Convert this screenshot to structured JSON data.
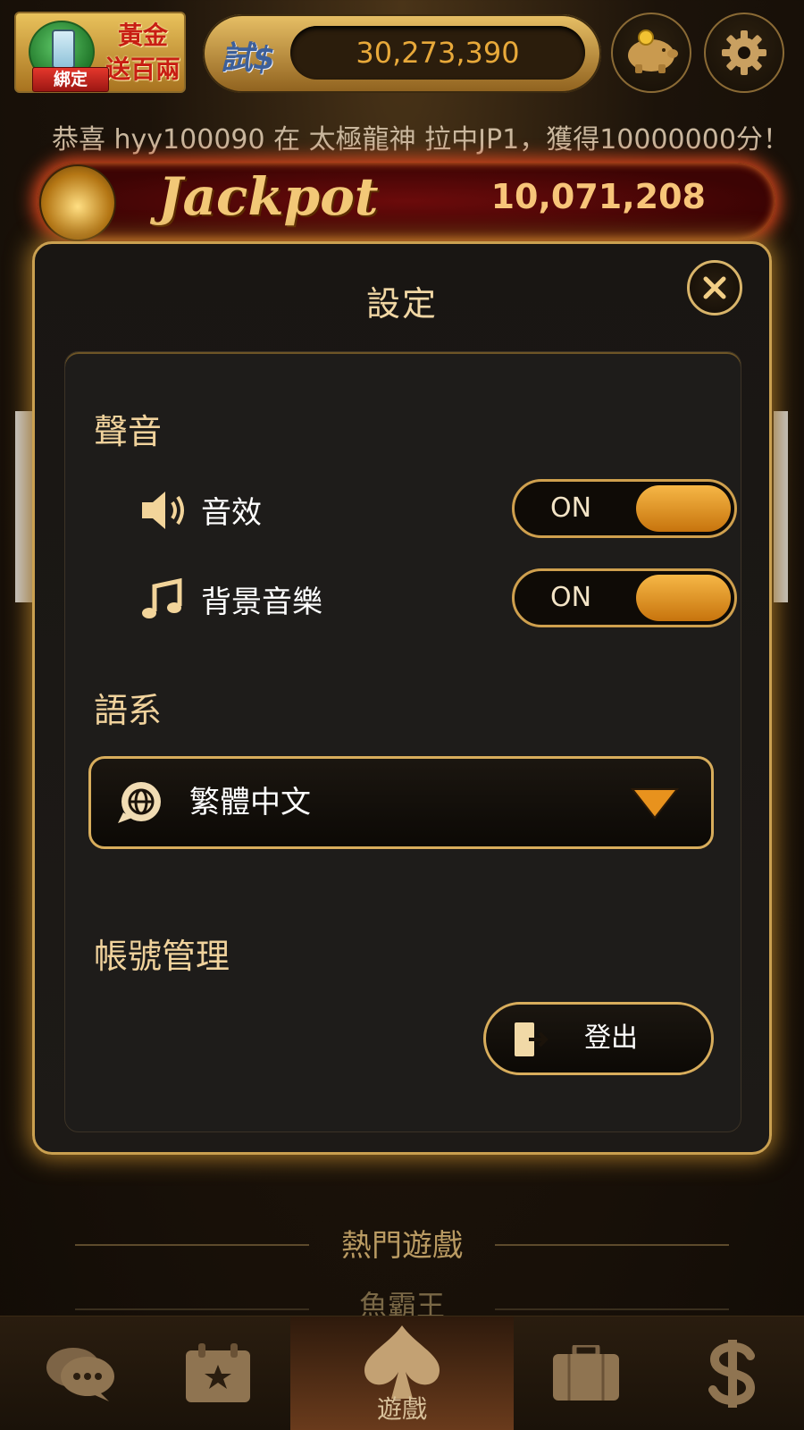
{
  "top_bar": {
    "promo_text": "黃金送百兩",
    "promo_line1": "黃金",
    "promo_line2": "送百兩",
    "bind_label": "綁定",
    "trial_label": "試$",
    "balance": "30,273,390"
  },
  "marquee": {
    "text": "恭喜 hyy100090 在 太極龍神 拉中JP1，獲得10000000分！"
  },
  "jackpot": {
    "title": "Jackpot",
    "value": "10,071,208"
  },
  "settings": {
    "title": "設定",
    "sound_section": "聲音",
    "sfx_label": "音效",
    "sfx_state": "ON",
    "bgm_label": "背景音樂",
    "bgm_state": "ON",
    "language_section": "語系",
    "language_value": "繁體中文",
    "account_section": "帳號管理",
    "logout_label": "登出"
  },
  "lobby": {
    "hot_games": "熱門遊戲",
    "next_category": "魚霸王"
  },
  "bottom_nav": {
    "items": [
      {
        "icon": "chat-icon",
        "label": ""
      },
      {
        "icon": "calendar-star-icon",
        "label": ""
      },
      {
        "icon": "spade-icon",
        "label": "遊戲",
        "active": true
      },
      {
        "icon": "briefcase-icon",
        "label": ""
      },
      {
        "icon": "dollar-icon",
        "label": ""
      }
    ]
  },
  "colors": {
    "gold": "#d8ad5c",
    "toggle_knob": "#f0a52f",
    "text_gold": "#f0d29c",
    "jackpot_glow": "#d3451d"
  }
}
